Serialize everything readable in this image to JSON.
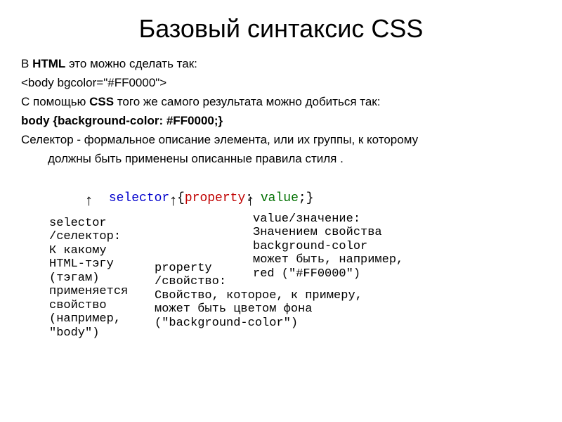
{
  "title": "Базовый синтаксис CSS",
  "p1_pre": "В ",
  "p1_bold": "HTML",
  "p1_post": " это можно сделать так:",
  "p2": "<body bgcolor=\"#FF0000\">",
  "p3_pre": "С помощью ",
  "p3_bold": "CSS",
  "p3_post": " того же самого результата можно добиться так:",
  "p4": " body {background-color: #FF0000;}",
  "p5": "Селектор - формальное описание элемента, или их группы, к которому",
  "p6": "должны быть применены описанные правила стиля .",
  "syntax": {
    "selector": "selector",
    "open": " {",
    "property": "property",
    "colon": ": ",
    "value": "value",
    "close": ";}"
  },
  "arrow": "↑",
  "anno_selector": "selector\n/селектор:\nК какому\nHTML-тэгу\n(тэгам)\nприменяется\nсвойство\n(например,\n\"body\")",
  "anno_property": "property\n/свойство:\nСвойство, которое, к примеру,\nможет быть цветом фона\n(\"background-color\")",
  "anno_value": "value/значение:\nЗначением свойства\nbackground-color\nможет быть, например,\nred (\"#FF0000\")"
}
